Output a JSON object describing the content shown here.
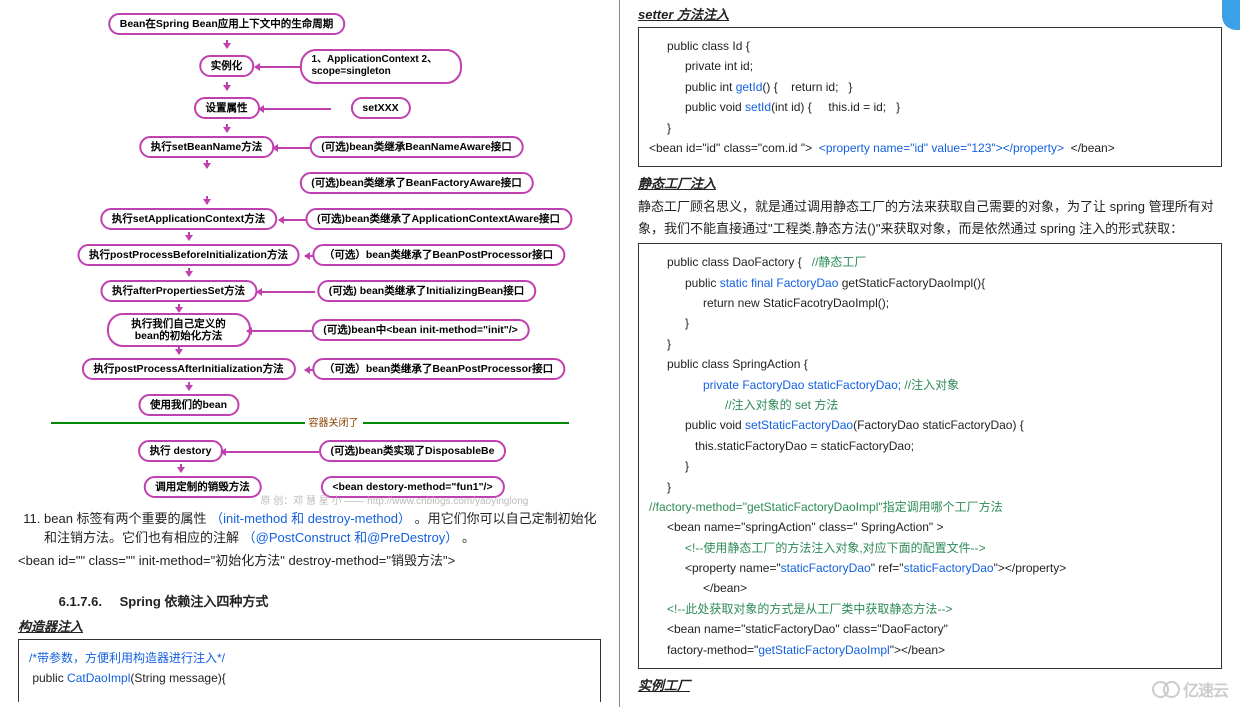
{
  "left": {
    "flow": {
      "n1": "Bean在Spring Bean应用上下文中的生命周期",
      "n2": "实例化",
      "n2r": "1、ApplicationContext\n2、scope=singleton",
      "n3": "设置属性",
      "n3r": "setXXX",
      "n4": "执行setBeanName方法",
      "n4r": "(可选)bean类继承BeanNameAware接口",
      "n5r": "(可选)bean类继承了BeanFactoryAware接口",
      "n6": "执行setApplicationContext方法",
      "n6r": "(可选)bean类继承了ApplicationContextAware接口",
      "n7": "执行postProcessBeforeInitialization方法",
      "n7r": "（可选）bean类继承了BeanPostProcessor接口",
      "n8": "执行afterPropertiesSet方法",
      "n8r": "(可选) bean类继承了InitializingBean接口",
      "n9": "执行我们自己定义的\nbean的初始化方法",
      "n9r": "(可选)bean中<bean init-method=\"init\"/>",
      "n10": "执行postProcessAfterInitialization方法",
      "n10r": "（可选）bean类继承了BeanPostProcessor接口",
      "n11": "使用我们的bean",
      "closed": "容器关闭了",
      "n12": "执行 destory",
      "n12r": "(可选)bean类实现了DisposableBe",
      "n13": "调用定制的销毁方法",
      "n13r": "<bean destory-method=\"fun1\"/>",
      "wm": "原 创：邓 慧 星 小 —— http://www.cnblogs.com/yaoyinglong"
    },
    "li11_a": "bean 标签有两个重要的属性",
    "li11_b": "（init-method 和 destroy-method）",
    "li11_c": "。用它们你可以自己定制初始化和注销方法。它们也有相应的注解",
    "li11_d": "（@PostConstruct 和@PreDestroy）",
    "li11_e": "。",
    "bean_xml": "<bean id=\"\" class=\"\" init-method=\"初始化方法\"  destroy-method=\"销毁方法\">",
    "section_no": "6.1.7.6.",
    "section_title": "Spring 依赖注入四种方式",
    "con_inject_head": "构造器注入",
    "con_code": {
      "l1": "/*带参数，方便利用构造器进行注入*/",
      "l2a": " public ",
      "l2b": "CatDaoImpl",
      "l2c": "(String message){"
    }
  },
  "right": {
    "setter_head": "setter 方法注入",
    "setter_code": {
      "l1": "public class Id {",
      "l2": "private int id;",
      "l3a": "public int ",
      "l3b": "getId",
      "l3c": "() {    return id;   }",
      "l4a": "public void ",
      "l4b": "setId",
      "l4c": "(int id) {     this.id = id;   }",
      "l5": "}",
      "l6a": "<bean id=\"id\" class=\"com.id \">  ",
      "l6b": "<property name=\"id\" value=\"123\"></property>",
      "l6c": "  </bean>"
    },
    "static_head": "静态工厂注入",
    "static_desc": "静态工厂顾名思义，就是通过调用静态工厂的方法来获取自己需要的对象，为了让 spring 管理所有对象，我们不能直接通过\"工程类.静态方法()\"来获取对象，而是依然通过 spring 注入的形式获取：",
    "static_code": {
      "l1a": "public class DaoFactory {   ",
      "l1b": "//静态工厂",
      "l2a": "public ",
      "l2b": "static final FactoryDao",
      "l2c": " getStaticFactoryDaoImpl(){",
      "l3": "return new StaticFacotryDaoImpl();",
      "l4": "}",
      "l5": "}",
      "l6": "public class SpringAction {",
      "l7a": "private FactoryDao staticFactoryDao;",
      "l7b": " //注入对象",
      "l8": "//注入对象的 set 方法",
      "l9a": "public void ",
      "l9b": "setStaticFactoryDao",
      "l9c": "(FactoryDao staticFactoryDao) {",
      "l10": "this.staticFactoryDao = staticFactoryDao;",
      "l11": "}",
      "l12": "}",
      "l13": "//factory-method=\"getStaticFactoryDaoImpl\"指定调用哪个工厂方法",
      "l14": "<bean name=\"springAction\" class=\" SpringAction\" >",
      "l15": "<!--使用静态工厂的方法注入对象,对应下面的配置文件-->",
      "l16a": "<property name=\"",
      "l16b": "staticFactoryDao",
      "l16c": "\" ref=\"",
      "l16d": "staticFactoryDao",
      "l16e": "\"></property>",
      "l17": "</bean>",
      "l18": "<!--此处获取对象的方式是从工厂类中获取静态方法-->",
      "l19": "<bean name=\"staticFactoryDao\" class=\"DaoFactory\"",
      "l20a": "factory-method=\"",
      "l20b": "getStaticFactoryDaoImpl",
      "l20c": "\"></bean>"
    },
    "inst_head": "实例工厂",
    "logo_text": "亿速云"
  }
}
